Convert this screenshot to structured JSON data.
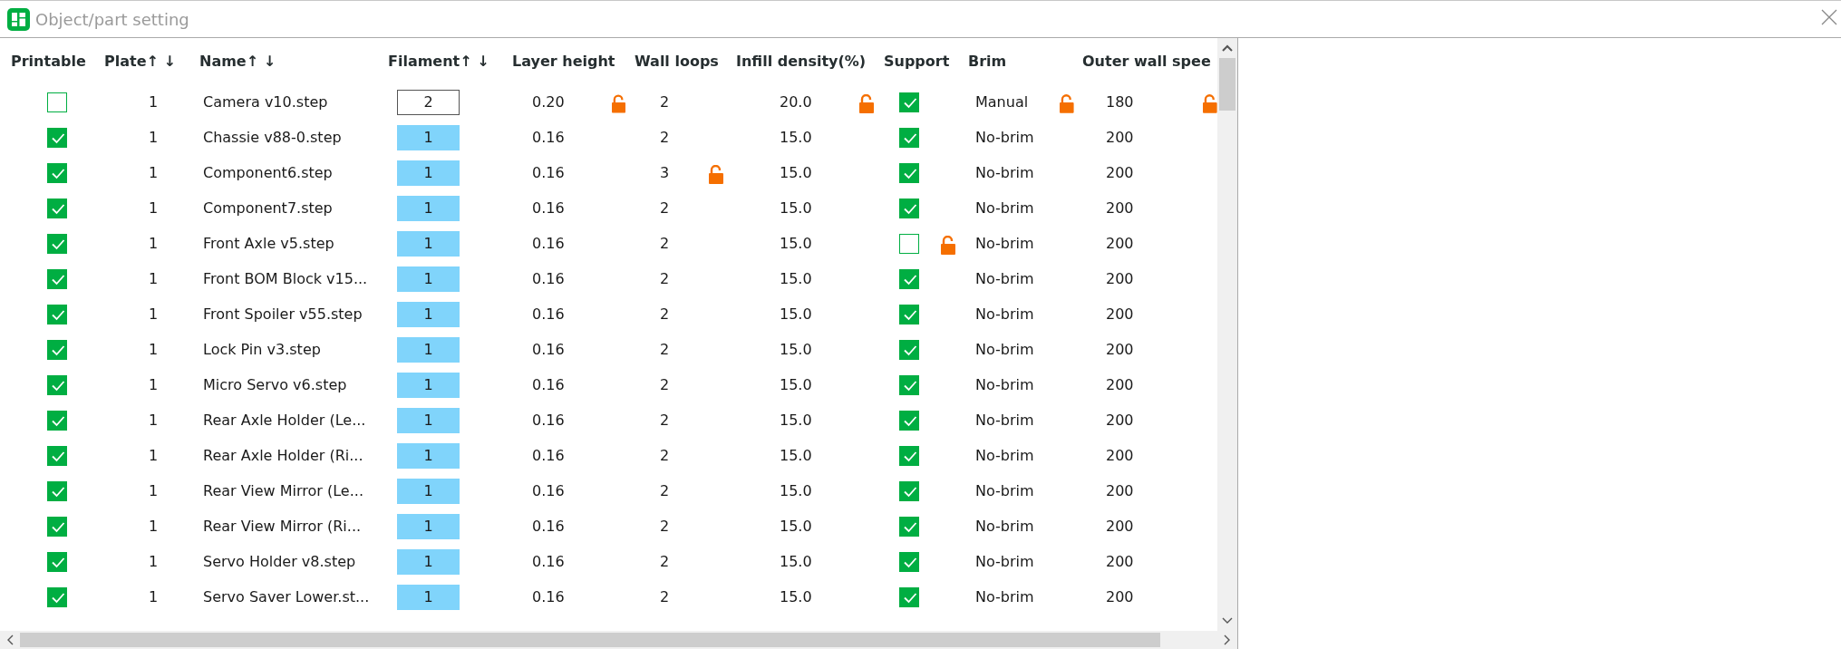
{
  "window": {
    "title": "Object/part setting"
  },
  "table": {
    "columns": [
      {
        "label": "Printable"
      },
      {
        "label": "Plate",
        "sort": "↑ ↓"
      },
      {
        "label": "Name",
        "sort": "↑ ↓"
      },
      {
        "label": "Filament",
        "sort": "↑ ↓"
      },
      {
        "label": "Layer height"
      },
      {
        "label": "Wall loops"
      },
      {
        "label": "Infill density(%)"
      },
      {
        "label": "Support"
      },
      {
        "label": "Brim"
      },
      {
        "label": "Outer wall spee"
      }
    ],
    "rows": [
      {
        "printable": false,
        "plate": "1",
        "name": "Camera v10.step",
        "filament": {
          "value": "2",
          "editing": true
        },
        "layer_height": {
          "value": "0.20",
          "unlocked": true
        },
        "wall_loops": {
          "value": "2",
          "unlocked": false
        },
        "infill": {
          "value": "20.0",
          "unlocked": true
        },
        "support": {
          "checked": true,
          "unlocked": false
        },
        "brim": {
          "value": "Manual",
          "unlocked": true
        },
        "outer_wall_speed": {
          "value": "180",
          "unlocked": true
        }
      },
      {
        "printable": true,
        "plate": "1",
        "name": "Chassie v88-0.step",
        "filament": {
          "value": "1",
          "editing": false
        },
        "layer_height": {
          "value": "0.16",
          "unlocked": false
        },
        "wall_loops": {
          "value": "2",
          "unlocked": false
        },
        "infill": {
          "value": "15.0",
          "unlocked": false
        },
        "support": {
          "checked": true,
          "unlocked": false
        },
        "brim": {
          "value": "No-brim",
          "unlocked": false
        },
        "outer_wall_speed": {
          "value": "200",
          "unlocked": false
        }
      },
      {
        "printable": true,
        "plate": "1",
        "name": "Component6.step",
        "filament": {
          "value": "1",
          "editing": false
        },
        "layer_height": {
          "value": "0.16",
          "unlocked": false
        },
        "wall_loops": {
          "value": "3",
          "unlocked": true
        },
        "infill": {
          "value": "15.0",
          "unlocked": false
        },
        "support": {
          "checked": true,
          "unlocked": false
        },
        "brim": {
          "value": "No-brim",
          "unlocked": false
        },
        "outer_wall_speed": {
          "value": "200",
          "unlocked": false
        }
      },
      {
        "printable": true,
        "plate": "1",
        "name": "Component7.step",
        "filament": {
          "value": "1",
          "editing": false
        },
        "layer_height": {
          "value": "0.16",
          "unlocked": false
        },
        "wall_loops": {
          "value": "2",
          "unlocked": false
        },
        "infill": {
          "value": "15.0",
          "unlocked": false
        },
        "support": {
          "checked": true,
          "unlocked": false
        },
        "brim": {
          "value": "No-brim",
          "unlocked": false
        },
        "outer_wall_speed": {
          "value": "200",
          "unlocked": false
        }
      },
      {
        "printable": true,
        "plate": "1",
        "name": "Front Axle v5.step",
        "filament": {
          "value": "1",
          "editing": false
        },
        "layer_height": {
          "value": "0.16",
          "unlocked": false
        },
        "wall_loops": {
          "value": "2",
          "unlocked": false
        },
        "infill": {
          "value": "15.0",
          "unlocked": false
        },
        "support": {
          "checked": false,
          "unlocked": true
        },
        "brim": {
          "value": "No-brim",
          "unlocked": false
        },
        "outer_wall_speed": {
          "value": "200",
          "unlocked": false
        }
      },
      {
        "printable": true,
        "plate": "1",
        "name": "Front BOM Block v15...",
        "filament": {
          "value": "1",
          "editing": false
        },
        "layer_height": {
          "value": "0.16",
          "unlocked": false
        },
        "wall_loops": {
          "value": "2",
          "unlocked": false
        },
        "infill": {
          "value": "15.0",
          "unlocked": false
        },
        "support": {
          "checked": true,
          "unlocked": false
        },
        "brim": {
          "value": "No-brim",
          "unlocked": false
        },
        "outer_wall_speed": {
          "value": "200",
          "unlocked": false
        }
      },
      {
        "printable": true,
        "plate": "1",
        "name": "Front Spoiler v55.step",
        "filament": {
          "value": "1",
          "editing": false
        },
        "layer_height": {
          "value": "0.16",
          "unlocked": false
        },
        "wall_loops": {
          "value": "2",
          "unlocked": false
        },
        "infill": {
          "value": "15.0",
          "unlocked": false
        },
        "support": {
          "checked": true,
          "unlocked": false
        },
        "brim": {
          "value": "No-brim",
          "unlocked": false
        },
        "outer_wall_speed": {
          "value": "200",
          "unlocked": false
        }
      },
      {
        "printable": true,
        "plate": "1",
        "name": "Lock Pin v3.step",
        "filament": {
          "value": "1",
          "editing": false
        },
        "layer_height": {
          "value": "0.16",
          "unlocked": false
        },
        "wall_loops": {
          "value": "2",
          "unlocked": false
        },
        "infill": {
          "value": "15.0",
          "unlocked": false
        },
        "support": {
          "checked": true,
          "unlocked": false
        },
        "brim": {
          "value": "No-brim",
          "unlocked": false
        },
        "outer_wall_speed": {
          "value": "200",
          "unlocked": false
        }
      },
      {
        "printable": true,
        "plate": "1",
        "name": "Micro Servo v6.step",
        "filament": {
          "value": "1",
          "editing": false
        },
        "layer_height": {
          "value": "0.16",
          "unlocked": false
        },
        "wall_loops": {
          "value": "2",
          "unlocked": false
        },
        "infill": {
          "value": "15.0",
          "unlocked": false
        },
        "support": {
          "checked": true,
          "unlocked": false
        },
        "brim": {
          "value": "No-brim",
          "unlocked": false
        },
        "outer_wall_speed": {
          "value": "200",
          "unlocked": false
        }
      },
      {
        "printable": true,
        "plate": "1",
        "name": "Rear Axle Holder (Le...",
        "filament": {
          "value": "1",
          "editing": false
        },
        "layer_height": {
          "value": "0.16",
          "unlocked": false
        },
        "wall_loops": {
          "value": "2",
          "unlocked": false
        },
        "infill": {
          "value": "15.0",
          "unlocked": false
        },
        "support": {
          "checked": true,
          "unlocked": false
        },
        "brim": {
          "value": "No-brim",
          "unlocked": false
        },
        "outer_wall_speed": {
          "value": "200",
          "unlocked": false
        }
      },
      {
        "printable": true,
        "plate": "1",
        "name": "Rear Axle Holder (Ri...",
        "filament": {
          "value": "1",
          "editing": false
        },
        "layer_height": {
          "value": "0.16",
          "unlocked": false
        },
        "wall_loops": {
          "value": "2",
          "unlocked": false
        },
        "infill": {
          "value": "15.0",
          "unlocked": false
        },
        "support": {
          "checked": true,
          "unlocked": false
        },
        "brim": {
          "value": "No-brim",
          "unlocked": false
        },
        "outer_wall_speed": {
          "value": "200",
          "unlocked": false
        }
      },
      {
        "printable": true,
        "plate": "1",
        "name": "Rear View Mirror (Le...",
        "filament": {
          "value": "1",
          "editing": false
        },
        "layer_height": {
          "value": "0.16",
          "unlocked": false
        },
        "wall_loops": {
          "value": "2",
          "unlocked": false
        },
        "infill": {
          "value": "15.0",
          "unlocked": false
        },
        "support": {
          "checked": true,
          "unlocked": false
        },
        "brim": {
          "value": "No-brim",
          "unlocked": false
        },
        "outer_wall_speed": {
          "value": "200",
          "unlocked": false
        }
      },
      {
        "printable": true,
        "plate": "1",
        "name": "Rear View Mirror (Ri...",
        "filament": {
          "value": "1",
          "editing": false
        },
        "layer_height": {
          "value": "0.16",
          "unlocked": false
        },
        "wall_loops": {
          "value": "2",
          "unlocked": false
        },
        "infill": {
          "value": "15.0",
          "unlocked": false
        },
        "support": {
          "checked": true,
          "unlocked": false
        },
        "brim": {
          "value": "No-brim",
          "unlocked": false
        },
        "outer_wall_speed": {
          "value": "200",
          "unlocked": false
        }
      },
      {
        "printable": true,
        "plate": "1",
        "name": "Servo Holder v8.step",
        "filament": {
          "value": "1",
          "editing": false
        },
        "layer_height": {
          "value": "0.16",
          "unlocked": false
        },
        "wall_loops": {
          "value": "2",
          "unlocked": false
        },
        "infill": {
          "value": "15.0",
          "unlocked": false
        },
        "support": {
          "checked": true,
          "unlocked": false
        },
        "brim": {
          "value": "No-brim",
          "unlocked": false
        },
        "outer_wall_speed": {
          "value": "200",
          "unlocked": false
        }
      },
      {
        "printable": true,
        "plate": "1",
        "name": "Servo Saver Lower.st...",
        "filament": {
          "value": "1",
          "editing": false
        },
        "layer_height": {
          "value": "0.16",
          "unlocked": false
        },
        "wall_loops": {
          "value": "2",
          "unlocked": false
        },
        "infill": {
          "value": "15.0",
          "unlocked": false
        },
        "support": {
          "checked": true,
          "unlocked": false
        },
        "brim": {
          "value": "No-brim",
          "unlocked": false
        },
        "outer_wall_speed": {
          "value": "200",
          "unlocked": false
        }
      }
    ]
  }
}
